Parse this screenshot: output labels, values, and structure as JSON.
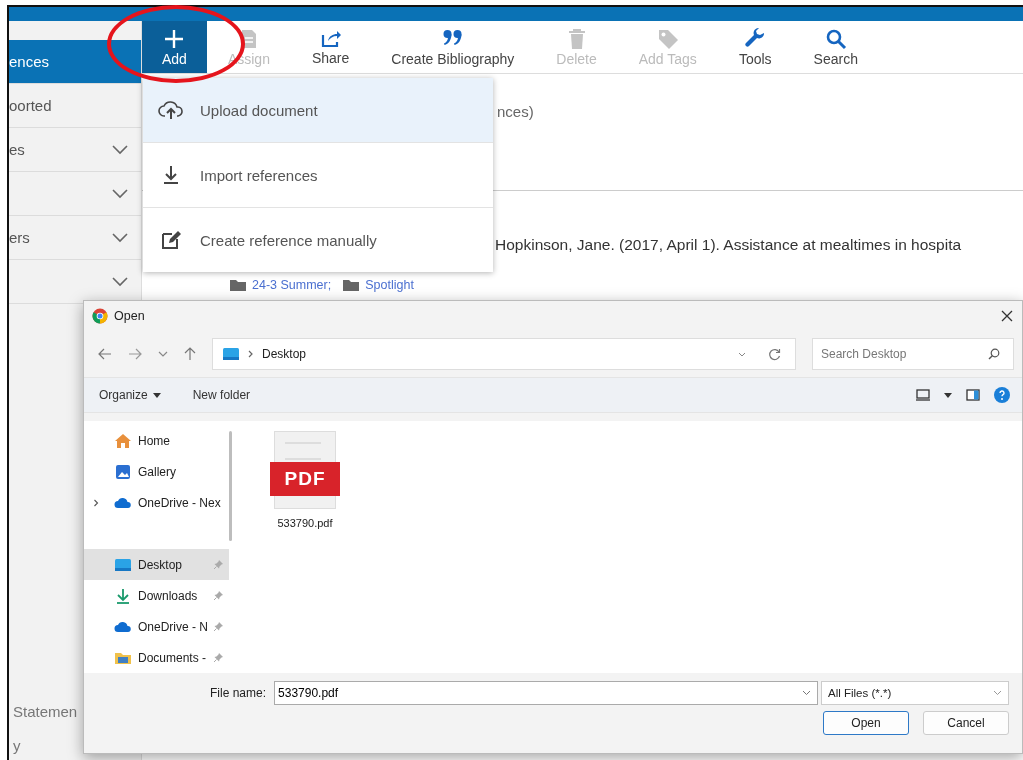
{
  "sidebar": {
    "items": [
      {
        "label": "ences",
        "selected": true,
        "expandable": false
      },
      {
        "label": "oorted",
        "selected": false,
        "expandable": false
      },
      {
        "label": "es",
        "selected": false,
        "expandable": true
      },
      {
        "selected": false,
        "expandable": true
      },
      {
        "label": "ers",
        "selected": false,
        "expandable": true
      },
      {
        "selected": false,
        "expandable": true
      }
    ],
    "bottom_items": [
      "Statemen",
      "y"
    ]
  },
  "toolbar": [
    {
      "label": "Add",
      "selected": true,
      "disabled": false
    },
    {
      "label": "Assign",
      "selected": false,
      "disabled": true
    },
    {
      "label": "Share",
      "selected": false,
      "disabled": false
    },
    {
      "label": "Create Bibliography",
      "selected": false,
      "disabled": false
    },
    {
      "label": "Delete",
      "selected": false,
      "disabled": true
    },
    {
      "label": "Add Tags",
      "selected": false,
      "disabled": true
    },
    {
      "label": "Tools",
      "selected": false,
      "disabled": false
    },
    {
      "label": "Search",
      "selected": false,
      "disabled": false
    }
  ],
  "content": {
    "count_text": "nces)",
    "reference": "Hopkinson, Jane. (2017, April 1). Assistance at mealtimes in hospita",
    "tags": [
      "24-3 Summer;",
      "Spotlight"
    ]
  },
  "add_menu": {
    "items": [
      {
        "label": "Upload document",
        "selected": true
      },
      {
        "label": "Import references",
        "selected": false
      },
      {
        "label": "Create reference manually",
        "selected": false
      }
    ]
  },
  "dialog": {
    "title": "Open",
    "path": [
      "Desktop"
    ],
    "search": {
      "placeholder": "Search Desktop"
    },
    "commands": [
      {
        "label": "Organize",
        "menu": true
      },
      {
        "label": "New folder",
        "menu": false
      }
    ],
    "nav": [
      {
        "label": "Home",
        "selected": false,
        "pinned": false,
        "expandable": false
      },
      {
        "label": "Gallery",
        "selected": false,
        "pinned": false,
        "expandable": false
      },
      {
        "label": "OneDrive - Nex",
        "selected": false,
        "pinned": false,
        "expandable": true
      }
    ],
    "quick_access": [
      {
        "label": "Desktop",
        "selected": true,
        "pinned": true,
        "expandable": false
      },
      {
        "label": "Downloads",
        "selected": false,
        "pinned": true,
        "expandable": false
      },
      {
        "label": "OneDrive - N",
        "selected": false,
        "pinned": true,
        "expandable": false
      },
      {
        "label": "Documents -",
        "selected": false,
        "pinned": true,
        "expandable": false
      }
    ],
    "files": [
      {
        "name": "533790.pdf",
        "badge": "PDF",
        "kind": "pdf"
      }
    ],
    "file_name_label": "File name:",
    "file_name": "533790.pdf",
    "filter": "All Files (*.*)",
    "buttons": [
      {
        "label": "Open",
        "default": true
      },
      {
        "label": "Cancel",
        "default": false
      }
    ]
  }
}
